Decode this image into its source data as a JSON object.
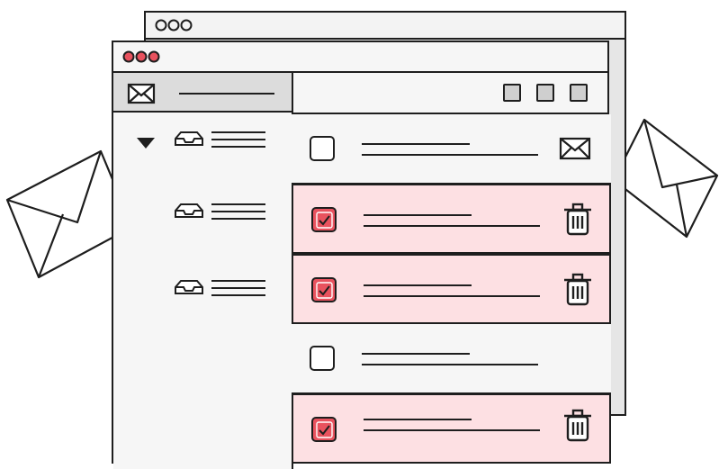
{
  "colors": {
    "outline": "#1e1e1e",
    "selected_row": "#fde0e3",
    "checkbox_checked": "#e8525e",
    "traffic_light": "#e8525e",
    "window_bg": "#f6f6f6",
    "sidebar_header": "#dcdcdc"
  },
  "icons": {
    "back_window_controls": "hollow-circles",
    "front_window_controls": "red-circles",
    "sidebar_header": "envelope-icon",
    "folder": "inbox-tray-icon",
    "row_unread": "envelope-icon",
    "row_delete": "trash-icon"
  },
  "sidebar": {
    "folders": [
      {
        "expanded": true
      },
      {
        "expanded": false
      },
      {
        "expanded": false
      }
    ]
  },
  "messages": [
    {
      "checked": false,
      "action": "envelope-icon"
    },
    {
      "checked": true,
      "action": "trash-icon"
    },
    {
      "checked": true,
      "action": "trash-icon"
    },
    {
      "checked": false,
      "action": "none"
    },
    {
      "checked": true,
      "action": "trash-icon"
    }
  ]
}
